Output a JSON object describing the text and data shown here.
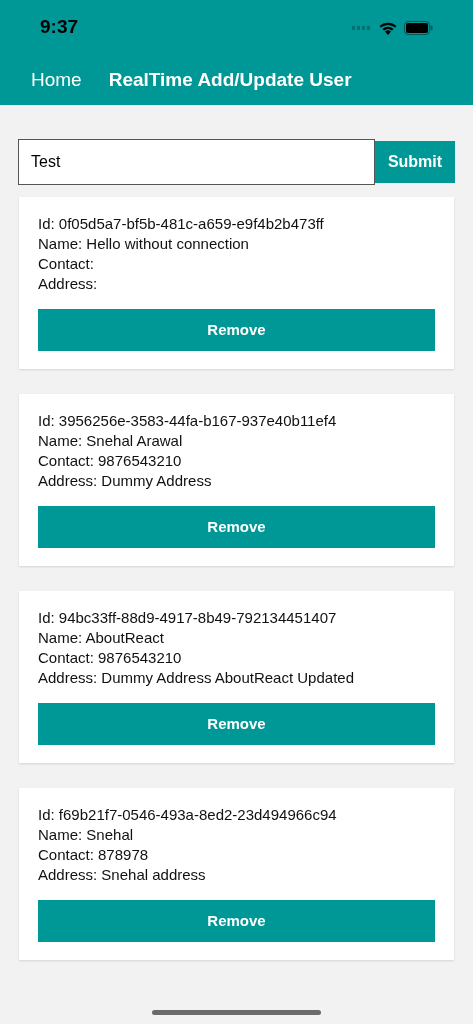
{
  "status_bar": {
    "time": "9:37"
  },
  "header": {
    "back_label": "Home",
    "title": "RealTime Add/Update User"
  },
  "form": {
    "value": "Test",
    "submit_label": "Submit"
  },
  "users": [
    {
      "lines": [
        "Id: 0f05d5a7-bf5b-481c-a659-e9f4b2b473ff",
        "Name: Hello without connection",
        "Contact:",
        "Address:"
      ],
      "button": "Remove"
    },
    {
      "lines": [
        "Id: 3956256e-3583-44fa-b167-937e40b11ef4",
        "Name: Snehal Arawal",
        "Contact: 9876543210",
        "Address: Dummy Address"
      ],
      "button": "Remove"
    },
    {
      "lines": [
        "Id: 94bc33ff-88d9-4917-8b49-792134451407",
        "Name: AboutReact",
        "Contact: 9876543210",
        "Address: Dummy Address AboutReact Updated"
      ],
      "button": "Remove"
    },
    {
      "lines": [
        "Id: f69b21f7-0546-493a-8ed2-23d494966c94",
        "Name: Snehal",
        "Contact: 878978",
        "Address: Snehal address"
      ],
      "button": "Remove"
    }
  ]
}
